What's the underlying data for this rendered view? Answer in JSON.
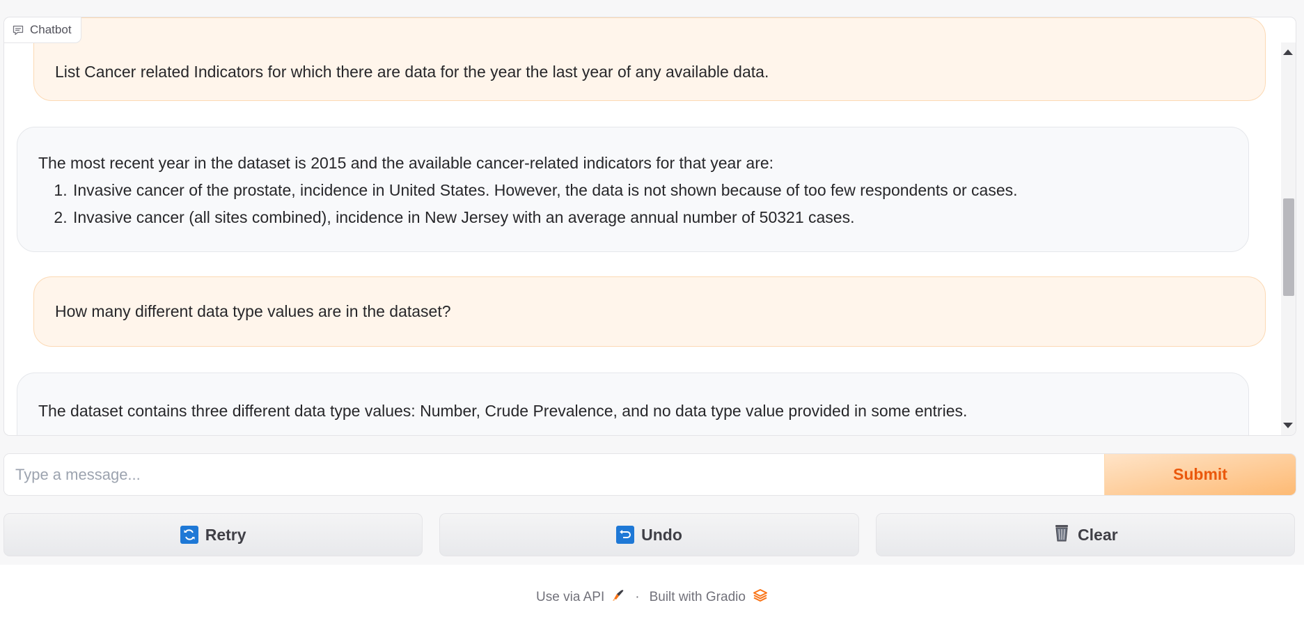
{
  "chatbot": {
    "label": "Chatbot",
    "label_icon": "chat-bubble-icon",
    "messages": [
      {
        "role": "user",
        "text": "List Cancer related Indicators for which there are data for the year the last year of any available data."
      },
      {
        "role": "bot",
        "intro": "The most recent year in the dataset is 2015 and the available cancer-related indicators for that year are:",
        "items": [
          "Invasive cancer of the prostate, incidence in United States. However, the data is not shown because of too few respondents or cases.",
          "Invasive cancer (all sites combined), incidence in New Jersey with an average annual number of 50321 cases."
        ]
      },
      {
        "role": "user",
        "text": "How many different data type values are in the dataset?"
      },
      {
        "role": "bot",
        "text": "The dataset contains three different data type values: Number, Crude Prevalence, and no data type value provided in some entries."
      }
    ]
  },
  "input": {
    "placeholder": "Type a message...",
    "value": "",
    "submit_label": "Submit"
  },
  "buttons": {
    "retry": {
      "label": "Retry",
      "icon": "retry-icon"
    },
    "undo": {
      "label": "Undo",
      "icon": "undo-icon"
    },
    "clear": {
      "label": "Clear",
      "icon": "trash-icon"
    }
  },
  "footer": {
    "api_label": "Use via API",
    "separator": "·",
    "built_label": "Built with Gradio"
  },
  "colors": {
    "accent": "#ea580c",
    "user_bubble": "#fff5eb",
    "bot_bubble": "#f8f9fb"
  }
}
